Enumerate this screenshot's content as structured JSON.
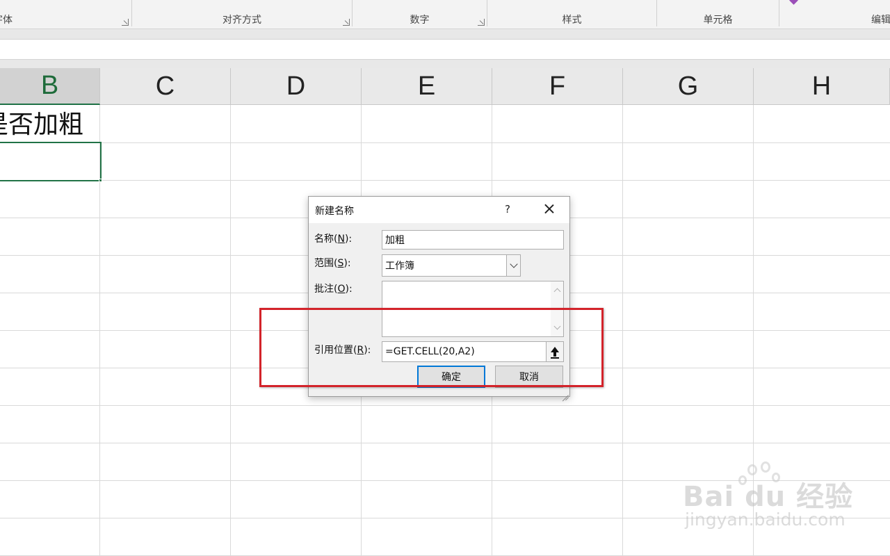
{
  "ribbon": {
    "groups": [
      {
        "label": "字体"
      },
      {
        "label": "对齐方式"
      },
      {
        "label": "数字"
      },
      {
        "label": "样式"
      },
      {
        "label": "单元格"
      },
      {
        "label": "编辑"
      }
    ]
  },
  "sheet": {
    "columns": [
      "B",
      "C",
      "D",
      "E",
      "F",
      "G",
      "H"
    ],
    "selected_column": "B",
    "cell_b1": "是否加粗"
  },
  "dialog": {
    "title": "新建名称",
    "help": "?",
    "name_label": "名称(N):",
    "name_label_hotkey": "N",
    "name_value": "加粗",
    "scope_label": "范围(S):",
    "scope_label_hotkey": "S",
    "scope_value": "工作簿",
    "comment_label": "批注(O):",
    "comment_label_hotkey": "O",
    "comment_value": "",
    "refers_to_label": "引用位置(R):",
    "refers_to_label_hotkey": "R",
    "refers_to_value": "=GET.CELL(20,A2)",
    "ok_label": "确定",
    "cancel_label": "取消"
  },
  "annotation": {
    "highlight_color": "#d3232a"
  },
  "watermark": {
    "logo": "Bai du 经验",
    "url": "jingyan.baidu.com"
  }
}
